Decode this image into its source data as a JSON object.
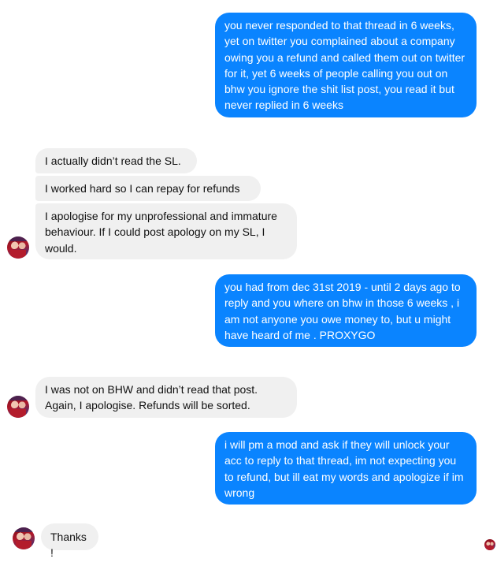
{
  "conversation": {
    "messages": [
      {
        "sender": "me",
        "text": "you never responded to that thread in 6 weeks, yet on twitter you complained about a company owing you a refund and called them out on twitter for it, yet 6 weeks of people calling you out on bhw you ignore the shit list post, you read it but never replied in 6 weeks"
      },
      {
        "sender": "them",
        "text": "I actually didn’t read the SL."
      },
      {
        "sender": "them",
        "text": "I worked hard so I can repay for refunds"
      },
      {
        "sender": "them",
        "text": "I apologise for my unprofessional and immature behaviour. If I could post apology on my SL, I would."
      },
      {
        "sender": "me",
        "text": "you had from dec 31st 2019 - until 2 days ago to reply and you where on bhw in those 6 weeks , i am not anyone you owe money to, but u might have heard of me . PROXYGO"
      },
      {
        "sender": "them",
        "text": "I was not on BHW and didn’t read that post. Again, I apologise. Refunds will be sorted."
      },
      {
        "sender": "me",
        "text": "i will pm a mod and ask if they will unlock your acc to reply to that thread, im not expecting you to refund, but ill eat my words and apologize if im wrong"
      },
      {
        "sender": "them",
        "text": "Thanks!"
      }
    ]
  },
  "colors": {
    "outgoing_bubble": "#0a84ff",
    "incoming_bubble": "#f0f0f0"
  },
  "icons": {
    "contact_avatar": "contact-avatar-icon",
    "seen_indicator": "seen-avatar-icon"
  }
}
